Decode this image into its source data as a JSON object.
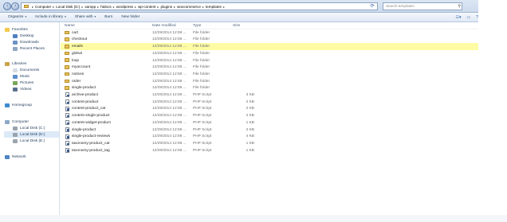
{
  "address": {
    "crumbs": [
      "Computer",
      "Local Disk (D:)",
      "xampp",
      "htdocs",
      "wordpress",
      "wp-content",
      "plugins",
      "woocommerce",
      "templates"
    ],
    "search_placeholder": "Search templates"
  },
  "toolbar": {
    "organize": "Organize",
    "include_in_library": "Include in library",
    "share_with": "Share with",
    "burn": "Burn",
    "new_folder": "New folder"
  },
  "nav": {
    "favorites": "Favorites",
    "desktop": "Desktop",
    "downloads": "Downloads",
    "recent_places": "Recent Places",
    "libraries": "Libraries",
    "documents": "Documents",
    "music": "Music",
    "pictures": "Pictures",
    "videos": "Videos",
    "homegroup": "Homegroup",
    "computer": "Computer",
    "disk_c": "Local Disk (C:)",
    "disk_d": "Local Disk (D:)",
    "disk_e": "Local Disk (E:)",
    "network": "Network"
  },
  "columns": {
    "name": "Name",
    "date_modified": "Date modified",
    "type": "Type",
    "size": "Size"
  },
  "files": [
    {
      "name": "cart",
      "date": "12/29/2014 12:59 ...",
      "type": "File folder",
      "size": "",
      "kind": "folder"
    },
    {
      "name": "checkout",
      "date": "12/29/2014 12:59 ...",
      "type": "File folder",
      "size": "",
      "kind": "folder"
    },
    {
      "name": "emails",
      "date": "12/29/2014 12:59 ...",
      "type": "File folder",
      "size": "",
      "kind": "folder"
    },
    {
      "name": "global",
      "date": "12/29/2014 12:59 ...",
      "type": "File folder",
      "size": "",
      "kind": "folder"
    },
    {
      "name": "loop",
      "date": "12/29/2014 12:59 ...",
      "type": "File folder",
      "size": "",
      "kind": "folder"
    },
    {
      "name": "myaccount",
      "date": "12/29/2014 12:59 ...",
      "type": "File folder",
      "size": "",
      "kind": "folder"
    },
    {
      "name": "notices",
      "date": "12/29/2014 12:59 ...",
      "type": "File folder",
      "size": "",
      "kind": "folder"
    },
    {
      "name": "order",
      "date": "12/29/2014 12:59 ...",
      "type": "File folder",
      "size": "",
      "kind": "folder"
    },
    {
      "name": "single-product",
      "date": "12/29/2014 12:59 ...",
      "type": "File folder",
      "size": "",
      "kind": "folder"
    },
    {
      "name": "archive-product",
      "date": "12/29/2014 12:59 ...",
      "type": "PHP Script",
      "size": "3 KB",
      "kind": "file"
    },
    {
      "name": "content-product",
      "date": "12/29/2014 12:59 ...",
      "type": "PHP Script",
      "size": "2 KB",
      "kind": "file"
    },
    {
      "name": "content-product_cat",
      "date": "12/29/2014 12:59 ...",
      "type": "PHP Script",
      "size": "2 KB",
      "kind": "file"
    },
    {
      "name": "content-single-product",
      "date": "12/29/2014 12:59 ...",
      "type": "PHP Script",
      "size": "2 KB",
      "kind": "file"
    },
    {
      "name": "content-widget-product",
      "date": "12/29/2014 12:59 ...",
      "type": "PHP Script",
      "size": "1 KB",
      "kind": "file"
    },
    {
      "name": "single-product",
      "date": "12/29/2014 12:59 ...",
      "type": "PHP Script",
      "size": "2 KB",
      "kind": "file"
    },
    {
      "name": "single-product-reviews",
      "date": "12/29/2014 12:59 ...",
      "type": "PHP Script",
      "size": "4 KB",
      "kind": "file"
    },
    {
      "name": "taxonomy-product_cat",
      "date": "12/29/2014 12:59 ...",
      "type": "PHP Script",
      "size": "1 KB",
      "kind": "file"
    },
    {
      "name": "taxonomy-product_tag",
      "date": "12/29/2014 12:59 ...",
      "type": "PHP Script",
      "size": "1 KB",
      "kind": "file"
    }
  ],
  "selected_file": "emails",
  "colors": {
    "selection": "#fdfca5",
    "folder": "#e8c25a",
    "text": "#1e395b"
  }
}
